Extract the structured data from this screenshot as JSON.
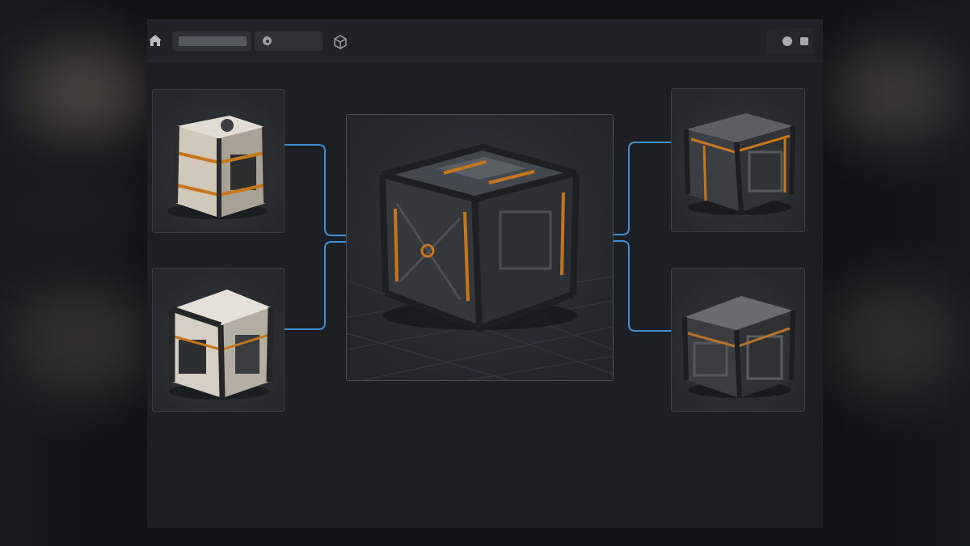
{
  "toolbar": {
    "icons": [
      "home-icon",
      "globe-icon",
      "cube-icon",
      "record-icon",
      "stop-icon"
    ]
  },
  "variants": [
    {
      "slot": "top-left",
      "style": "white-orange"
    },
    {
      "slot": "bottom-left",
      "style": "white-black"
    },
    {
      "slot": "top-right",
      "style": "dark-orange"
    },
    {
      "slot": "bottom-right",
      "style": "dark-gray"
    }
  ],
  "main_preview": {
    "style": "dark-orange",
    "grid": true
  },
  "colors": {
    "connector": "#3f8fd0",
    "accent": "#c8761c",
    "panel": "#1c1f23",
    "card_border": "#3b3f44"
  }
}
